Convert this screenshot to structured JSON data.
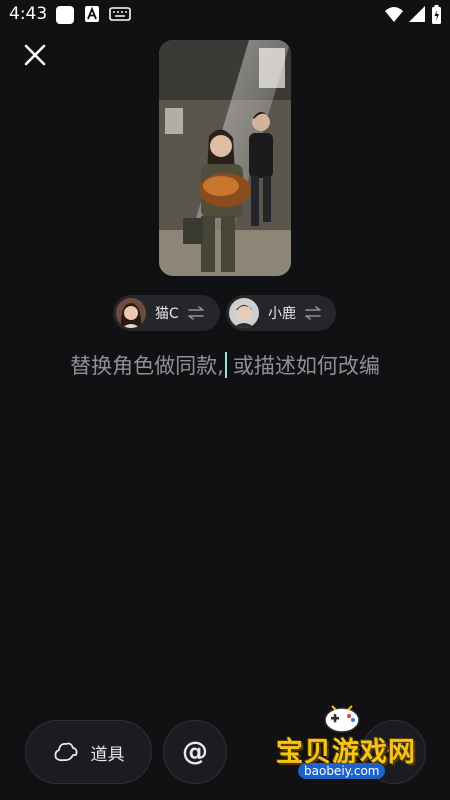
{
  "status_bar": {
    "time": "4:43"
  },
  "top": {
    "close_icon": "close-icon"
  },
  "characters": [
    {
      "name": "猫C",
      "avatar_icon": "avatar",
      "swap_icon": "swap-arrows-icon"
    },
    {
      "name": "小鹿",
      "avatar_icon": "avatar",
      "swap_icon": "swap-arrows-icon"
    }
  ],
  "prompt": {
    "text_before_cursor": "替换角色做同款,",
    "text_after_cursor": "或描述如何改编"
  },
  "bottom_bar": {
    "props_label": "道具",
    "props_icon": "hat-icon",
    "mention_label": "@",
    "send_icon": "send-icon"
  },
  "watermark": {
    "text": "宝贝游戏网",
    "url": "baobeiy.com"
  },
  "colors": {
    "background": "#111114",
    "chip_background": "#25262b",
    "cursor": "#8fe3d8",
    "prompt_text": "#8e9096"
  }
}
